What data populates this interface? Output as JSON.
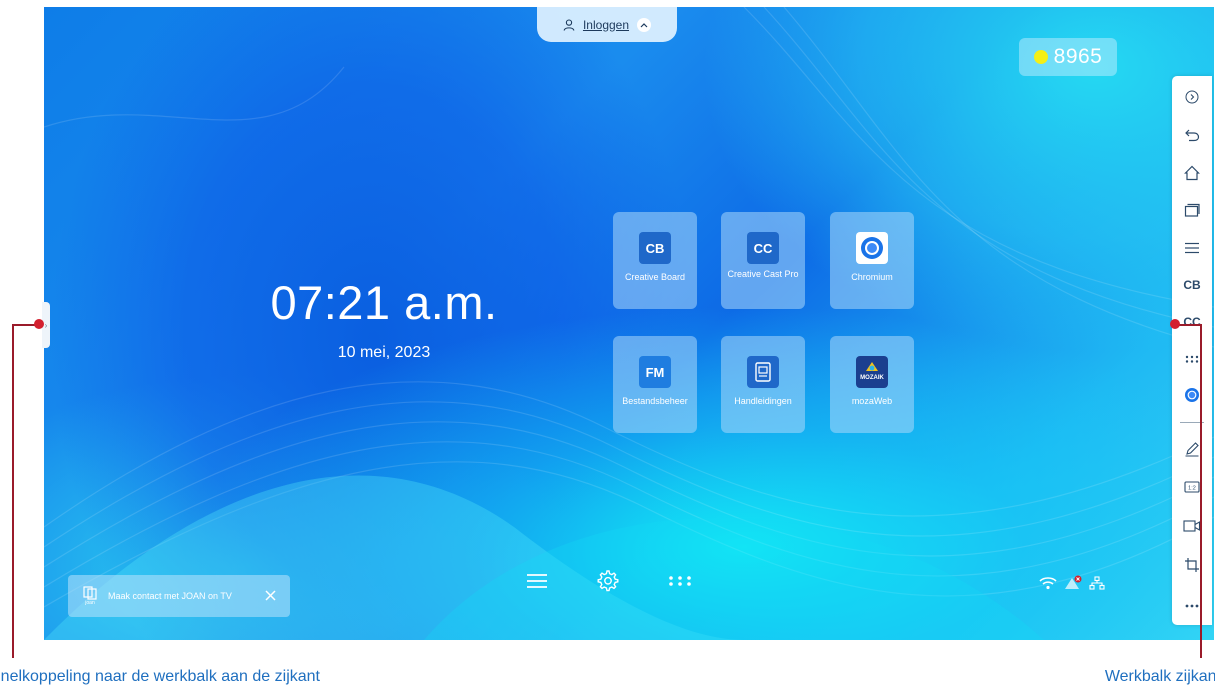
{
  "login": {
    "label": "Inloggen"
  },
  "score": {
    "value": "8965"
  },
  "clock": {
    "time": "07:21 a.m.",
    "date": "10 mei, 2023"
  },
  "apps": [
    {
      "label": "Creative Board",
      "glyph": "CB",
      "color": "#1f68c9"
    },
    {
      "label": "Creative Cast Pro",
      "glyph": "CC",
      "color": "#1f68c9"
    },
    {
      "label": "Chromium",
      "glyph": "",
      "color": "#ffffff"
    },
    {
      "label": "Bestandsbeheer",
      "glyph": "FM",
      "color": "#1f7de0"
    },
    {
      "label": "Handleidingen",
      "glyph": "",
      "color": "#1f68c9"
    },
    {
      "label": "mozaWeb",
      "glyph": "MOZAIK",
      "color": "#1b3f8f"
    }
  ],
  "sidebar": [
    {
      "icon": "expand-icon"
    },
    {
      "icon": "back-icon"
    },
    {
      "icon": "home-icon"
    },
    {
      "icon": "recent-apps-icon"
    },
    {
      "icon": "menu-icon"
    },
    {
      "icon": "creative-board-icon"
    },
    {
      "icon": "creative-cast-icon"
    },
    {
      "icon": "apps-grid-icon"
    },
    {
      "icon": "chromium-icon"
    },
    {
      "icon": "pen-icon"
    },
    {
      "icon": "split-screen-icon"
    },
    {
      "icon": "screen-record-icon"
    },
    {
      "icon": "crop-icon"
    },
    {
      "icon": "more-icon"
    }
  ],
  "toast": {
    "brand": "joan",
    "text": "Maak contact met JOAN on TV"
  },
  "dock": [
    "menu-icon",
    "settings-icon",
    "apps-icon"
  ],
  "captions": {
    "left": "Snelkoppeling naar de werkbalk aan de zijkant",
    "right": "Werkbalk zijkant"
  },
  "colors": {
    "accent": "#1f6fbf",
    "callout": "#d3202f",
    "coin": "#f5ef15"
  }
}
